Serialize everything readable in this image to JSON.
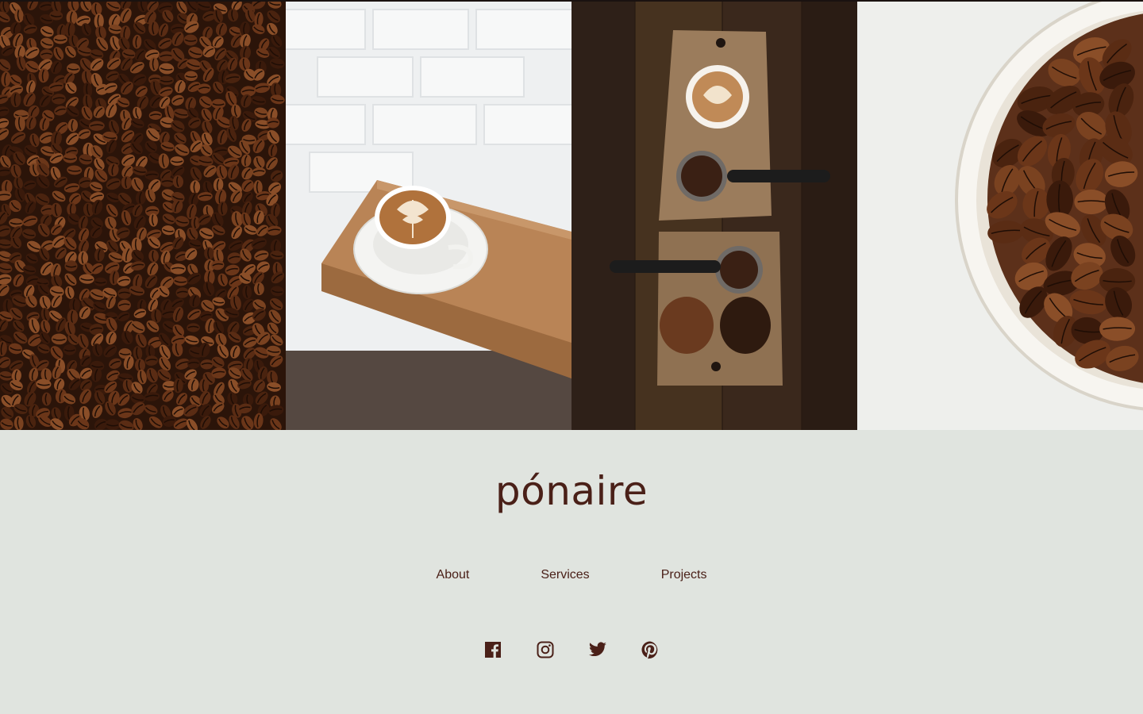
{
  "gallery": {
    "images": [
      {
        "icon": "coffee-beans-scattered-image"
      },
      {
        "icon": "latte-on-wooden-shelf-image"
      },
      {
        "icon": "espresso-tools-on-boards-image"
      },
      {
        "icon": "bowl-of-coffee-beans-image"
      }
    ]
  },
  "brand": {
    "name": "pónaire",
    "color": "#4a2018"
  },
  "nav": {
    "items": [
      {
        "label": "About"
      },
      {
        "label": "Services"
      },
      {
        "label": "Projects"
      }
    ]
  },
  "social": {
    "icons": [
      "facebook-icon",
      "instagram-icon",
      "twitter-icon",
      "pinterest-icon"
    ]
  },
  "colors": {
    "background": "#e0e4df",
    "text": "#4a2018"
  }
}
